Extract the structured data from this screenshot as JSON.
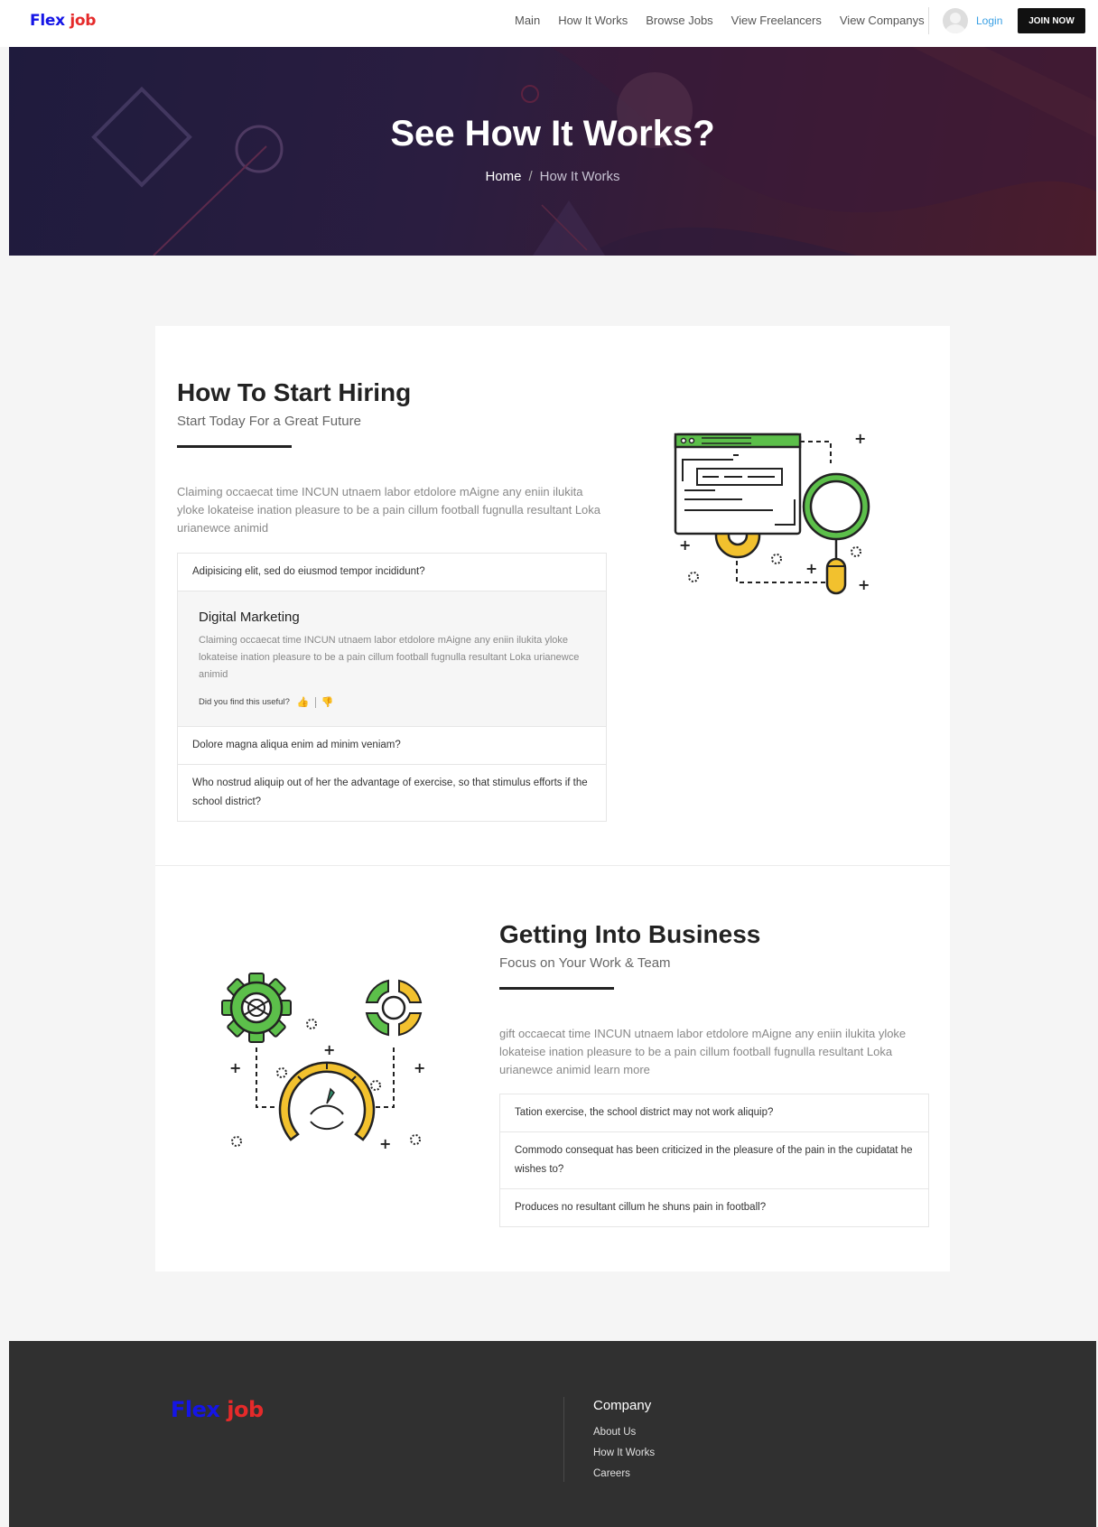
{
  "brand": {
    "part1": "Flex",
    "part2": "job"
  },
  "nav": {
    "items": [
      "Main",
      "How It Works",
      "Browse Jobs",
      "View Freelancers",
      "View Companys"
    ],
    "login": "Login",
    "join": "JOIN NOW"
  },
  "hero": {
    "title": "See How It Works?",
    "breadcrumb": {
      "home": "Home",
      "separator": "/",
      "current": "How It Works"
    }
  },
  "section1": {
    "title": "How To Start Hiring",
    "subtitle": "Start Today For a Great Future",
    "text": "Claiming occaecat time INCUN utnaem labor etdolore mAigne any eniin ilukita yloke lokateise ination pleasure to be a pain cillum football fugnulla resultant Loka urianewce animid",
    "faq": [
      "Adipisicing elit, sed do eiusmod tempor incididunt?",
      "Dolore magna aliqua enim ad minim veniam?",
      "Who nostrud aliquip out of her the advantage of exercise, so that stimulus efforts if the school district?"
    ],
    "open": {
      "title": "Digital Marketing",
      "text": "Claiming occaecat time INCUN utnaem labor etdolore mAigne any eniin ilukita yloke lokateise ination pleasure to be a pain cillum football fugnulla resultant Loka urianewce animid",
      "useful": "Did you find this useful?"
    }
  },
  "section2": {
    "title": "Getting Into Business",
    "subtitle": "Focus on Your Work & Team",
    "text": "gift occaecat time INCUN utnaem labor etdolore mAigne any eniin ilukita yloke lokateise ination pleasure to be a pain cillum football fugnulla resultant Loka urianewce animid learn more",
    "faq": [
      "Tation exercise, the school district may not work aliquip?",
      "Commodo consequat has been criticized in the pleasure of the pain in the cupidatat he wishes to?",
      "Produces no resultant cillum he shuns pain in football?"
    ]
  },
  "footer": {
    "heading": "Company",
    "links": [
      "About Us",
      "How It Works",
      "Careers"
    ]
  },
  "colors": {
    "accent_green": "#5cbf4a",
    "accent_yellow": "#f2c12e",
    "dark": "#222222",
    "link_blue": "#3aa0e4"
  }
}
